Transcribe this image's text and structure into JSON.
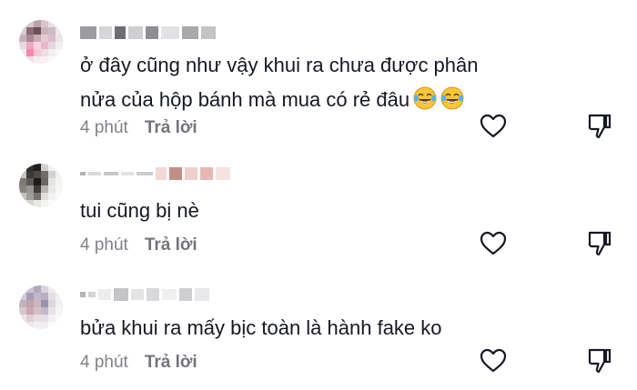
{
  "comments": [
    {
      "text_lines": [
        "ở đây cũng như vậy khui ra chưa được phân",
        "nửa của hộp bánh mà mua có rẻ đâu"
      ],
      "emoji": [
        "face-with-tears-of-joy-icon",
        "face-with-tears-of-joy-icon"
      ],
      "time": "4 phút",
      "reply_label": "Trả lời"
    },
    {
      "text_lines": [
        "tui cũng bị nè"
      ],
      "time": "4 phút",
      "reply_label": "Trả lời"
    },
    {
      "text_lines": [
        "bửa khui ra mấy bịc toàn là hành fake ko"
      ],
      "time": "4 phút",
      "reply_label": "Trả lời"
    }
  ],
  "icons": {
    "like": "heart-outline-icon",
    "dislike": "thumbs-down-icon"
  },
  "colors": {
    "text": "#161823",
    "meta": "#8a8b91",
    "icon": "#161823"
  }
}
